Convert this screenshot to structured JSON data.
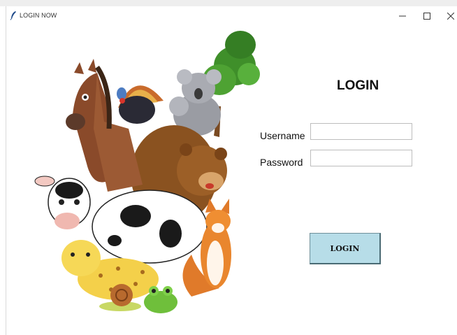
{
  "window": {
    "title": "LOGIN NOW",
    "controls": [
      "minimize-icon",
      "maximize-icon",
      "close-icon"
    ]
  },
  "form": {
    "heading": "LOGIN",
    "username_label": "Username",
    "username_value": "",
    "password_label": "Password",
    "password_value": "",
    "button_label": "LOGIN"
  },
  "colors": {
    "button_bg": "#b7dde8",
    "background": "#ffffff"
  },
  "illustration": {
    "subject": "cartoon-animals-group"
  }
}
